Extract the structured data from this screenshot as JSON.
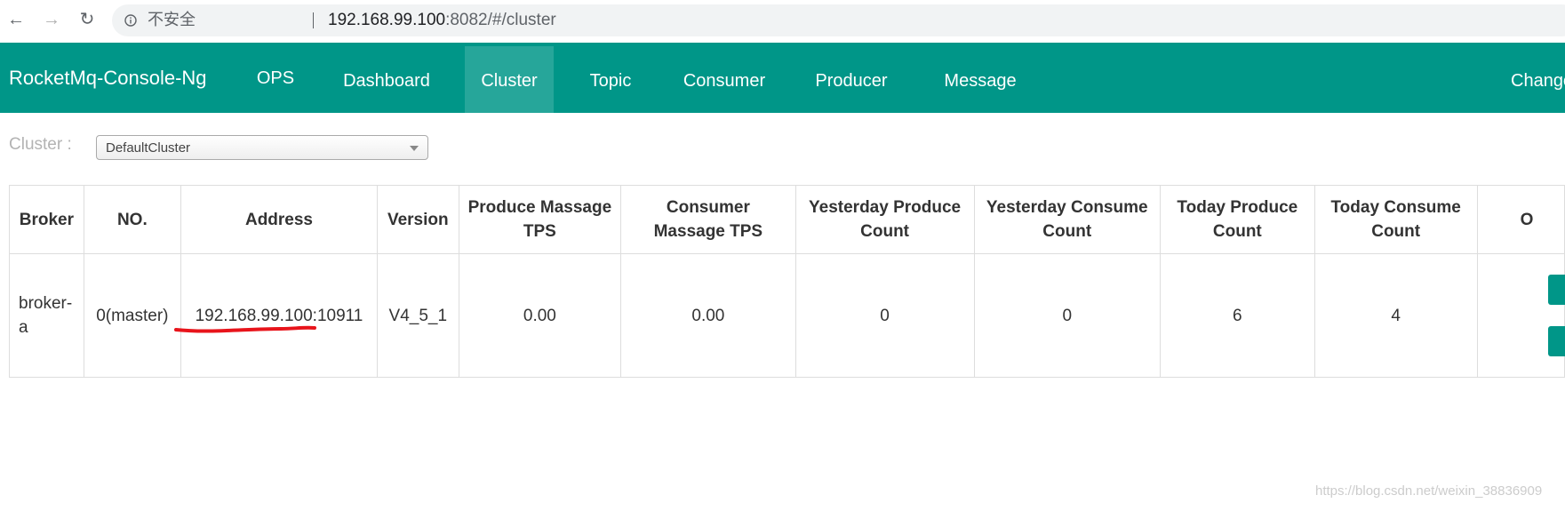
{
  "browser": {
    "insecure_label": "不安全",
    "url_host": "192.168.99.100",
    "url_rest": ":8082/#/cluster"
  },
  "navbar": {
    "brand": "RocketMq-Console-Ng",
    "items": [
      {
        "label": "OPS"
      },
      {
        "label": "Dashboard"
      },
      {
        "label": "Cluster",
        "active": true
      },
      {
        "label": "Topic"
      },
      {
        "label": "Consumer"
      },
      {
        "label": "Producer"
      },
      {
        "label": "Message"
      },
      {
        "label": "Change"
      }
    ]
  },
  "cluster_select": {
    "label": "Cluster :",
    "value": "DefaultCluster"
  },
  "table": {
    "headers": [
      "Broker",
      "NO.",
      "Address",
      "Version",
      "Produce Massage TPS",
      "Consumer Massage TPS",
      "Yesterday Produce Count",
      "Yesterday Consume Count",
      "Today Produce Count",
      "Today Consume Count",
      "O"
    ],
    "rows": [
      {
        "broker": "broker-a",
        "no": "0(master)",
        "address": "192.168.99.100:10911",
        "version": "V4_5_1",
        "produce_tps": "0.00",
        "consumer_tps": "0.00",
        "yesterday_produce": "0",
        "yesterday_consume": "0",
        "today_produce": "6",
        "today_consume": "4"
      }
    ]
  },
  "annotation_color": "#e8141b",
  "accent_color": "#009688",
  "watermark": "https://blog.csdn.net/weixin_38836909"
}
